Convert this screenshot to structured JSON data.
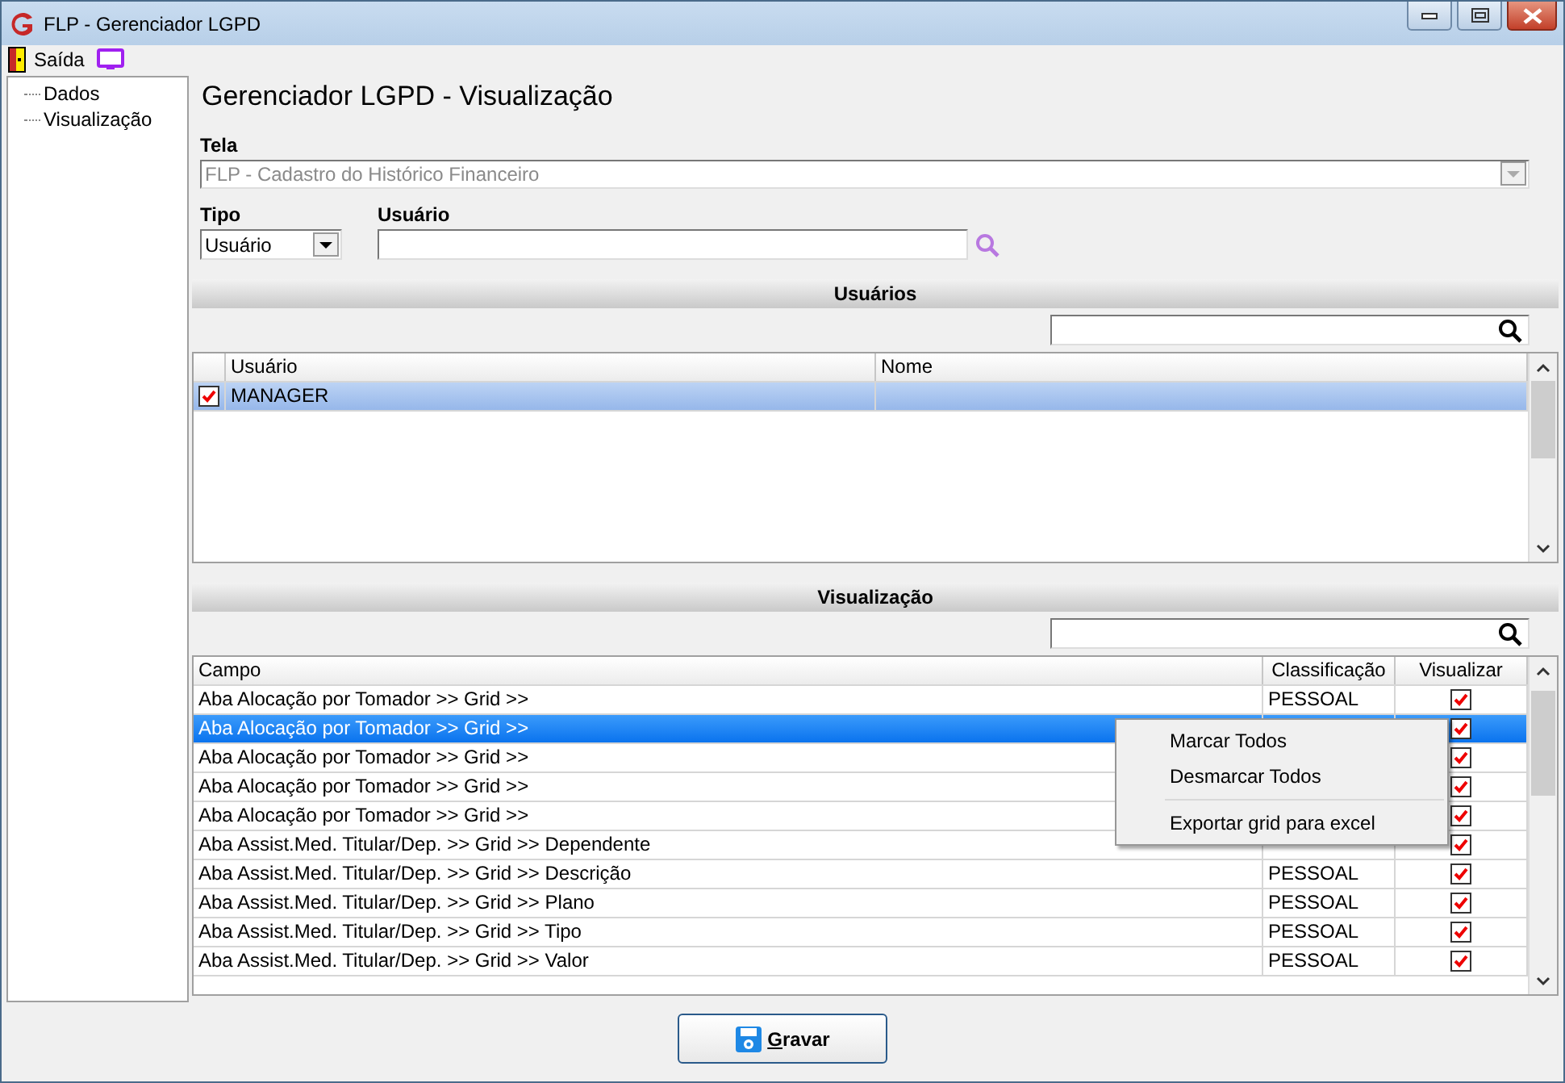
{
  "window": {
    "title": "FLP - Gerenciador LGPD"
  },
  "toolbar": [
    {
      "kind": "exit",
      "label": "Saída"
    },
    {
      "kind": "monitor"
    }
  ],
  "tree": {
    "items": [
      {
        "label": "Dados"
      },
      {
        "label": "Visualização"
      }
    ]
  },
  "page_title": "Gerenciador LGPD - Visualização",
  "tela": {
    "label": "Tela",
    "value": "FLP - Cadastro do Histórico Financeiro",
    "disabled": true
  },
  "tipo": {
    "label": "Tipo",
    "value": "Usuário"
  },
  "usuario": {
    "label": "Usuário"
  },
  "users_section": {
    "title": "Usuários",
    "columns": [
      "Usuário",
      "Nome"
    ],
    "rows": [
      {
        "usuario": "MANAGER",
        "checked": true,
        "selected": true
      }
    ]
  },
  "fields_section": {
    "title": "Visualização",
    "columns": [
      "Campo",
      "Classificação",
      "Visualizar"
    ],
    "rows": [
      {
        "campo": "Aba Alocação por Tomador >> Grid >>",
        "classificacao": "PESSOAL",
        "visualizar": true,
        "selected": false
      },
      {
        "campo": "Aba Alocação por Tomador >> Grid >>",
        "visualizar": true,
        "selected": true
      },
      {
        "campo": "Aba Alocação por Tomador >> Grid >>",
        "visualizar": true,
        "selected": false
      },
      {
        "campo": "Aba Alocação por Tomador >> Grid >>",
        "visualizar": true,
        "selected": false
      },
      {
        "campo": "Aba Alocação por Tomador >> Grid >>",
        "visualizar": true,
        "selected": false
      },
      {
        "campo": "Aba Assist.Med. Titular/Dep. >> Grid >> Dependente",
        "visualizar": true,
        "selected": false
      },
      {
        "campo": "Aba Assist.Med. Titular/Dep. >> Grid >> Descrição",
        "classificacao": "PESSOAL",
        "visualizar": true,
        "selected": false
      },
      {
        "campo": "Aba Assist.Med. Titular/Dep. >> Grid >> Plano",
        "classificacao": "PESSOAL",
        "visualizar": true,
        "selected": false
      },
      {
        "campo": "Aba Assist.Med. Titular/Dep. >> Grid >> Tipo",
        "classificacao": "PESSOAL",
        "visualizar": true,
        "selected": false
      },
      {
        "campo": "Aba Assist.Med. Titular/Dep. >> Grid >> Valor",
        "classificacao": "PESSOAL",
        "visualizar": true,
        "selected": false
      }
    ]
  },
  "context_menu": {
    "items": [
      {
        "kind": "item",
        "label": "Marcar Todos"
      },
      {
        "kind": "item",
        "label": "Desmarcar Todos"
      },
      {
        "kind": "separator"
      },
      {
        "kind": "item",
        "label": "Exportar grid para excel"
      }
    ]
  },
  "buttons": [
    {
      "kind": "save",
      "label": "Gravar"
    }
  ]
}
